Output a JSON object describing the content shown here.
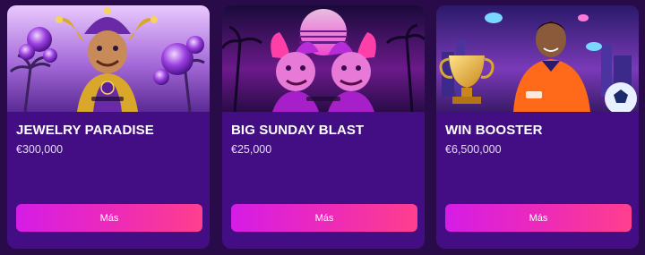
{
  "promotions": [
    {
      "title": "JEWELRY PARADISE",
      "prize": "€300,000",
      "button_label": "Más",
      "art": "jester-with-purple-gems-icon",
      "accent": "#7a35c4"
    },
    {
      "title": "BIG SUNDAY BLAST",
      "prize": "€25,000",
      "button_label": "Más",
      "art": "twin-jesters-neon-sunset-icon",
      "accent": "#ff4fd8"
    },
    {
      "title": "WIN BOOSTER",
      "prize": "€6,500,000",
      "button_label": "Más",
      "art": "football-player-trophy-icon",
      "accent": "#ff7a1a"
    }
  ],
  "colors": {
    "page_bg": "#2a0b49",
    "card_bg": "#430e84",
    "button_start": "#d51ce6",
    "button_end": "#ff3f8d",
    "title_text": "#ffffff"
  }
}
